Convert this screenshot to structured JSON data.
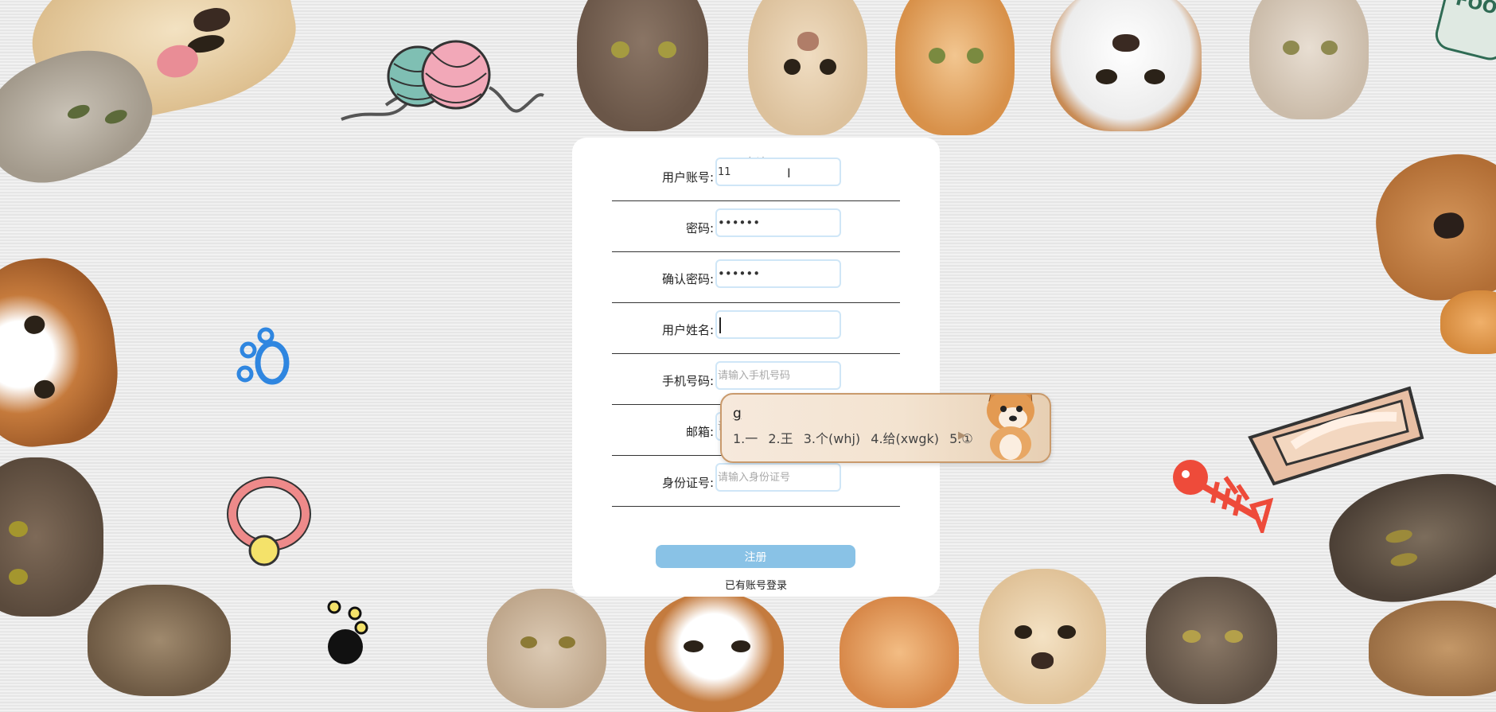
{
  "form": {
    "title": "用户注册",
    "fields": [
      {
        "label": "用户账号:",
        "value": "11",
        "placeholder": ""
      },
      {
        "label": "密码:",
        "value": "••••••",
        "placeholder": ""
      },
      {
        "label": "确认密码:",
        "value": "••••••",
        "placeholder": ""
      },
      {
        "label": "用户姓名:",
        "value": "",
        "placeholder": ""
      },
      {
        "label": "手机号码:",
        "value": "",
        "placeholder": "请输入手机号码"
      },
      {
        "label": "邮箱:",
        "value": "",
        "placeholder": "请输入邮箱"
      },
      {
        "label": "身份证号:",
        "value": "",
        "placeholder": "请输入身份证号"
      }
    ],
    "submit_label": "注册",
    "login_link": "已有账号登录"
  },
  "ime": {
    "composition": "g",
    "candidates": [
      "1.一",
      "2.王",
      "3.个(whj)",
      "4.给(xwgk)",
      "5.①"
    ],
    "next_arrow": "▶"
  },
  "colors": {
    "submit": "#89c2e6",
    "input_border": "#cfe6f7",
    "ime_border": "#c99a6c"
  },
  "background": {
    "decor_icons": [
      "dog-icon",
      "cat-icon",
      "yarn-ball-icon",
      "paw-print-icon",
      "pet-collar-icon",
      "fish-bone-icon",
      "pet-bed-icon",
      "pet-food-can-icon"
    ]
  }
}
